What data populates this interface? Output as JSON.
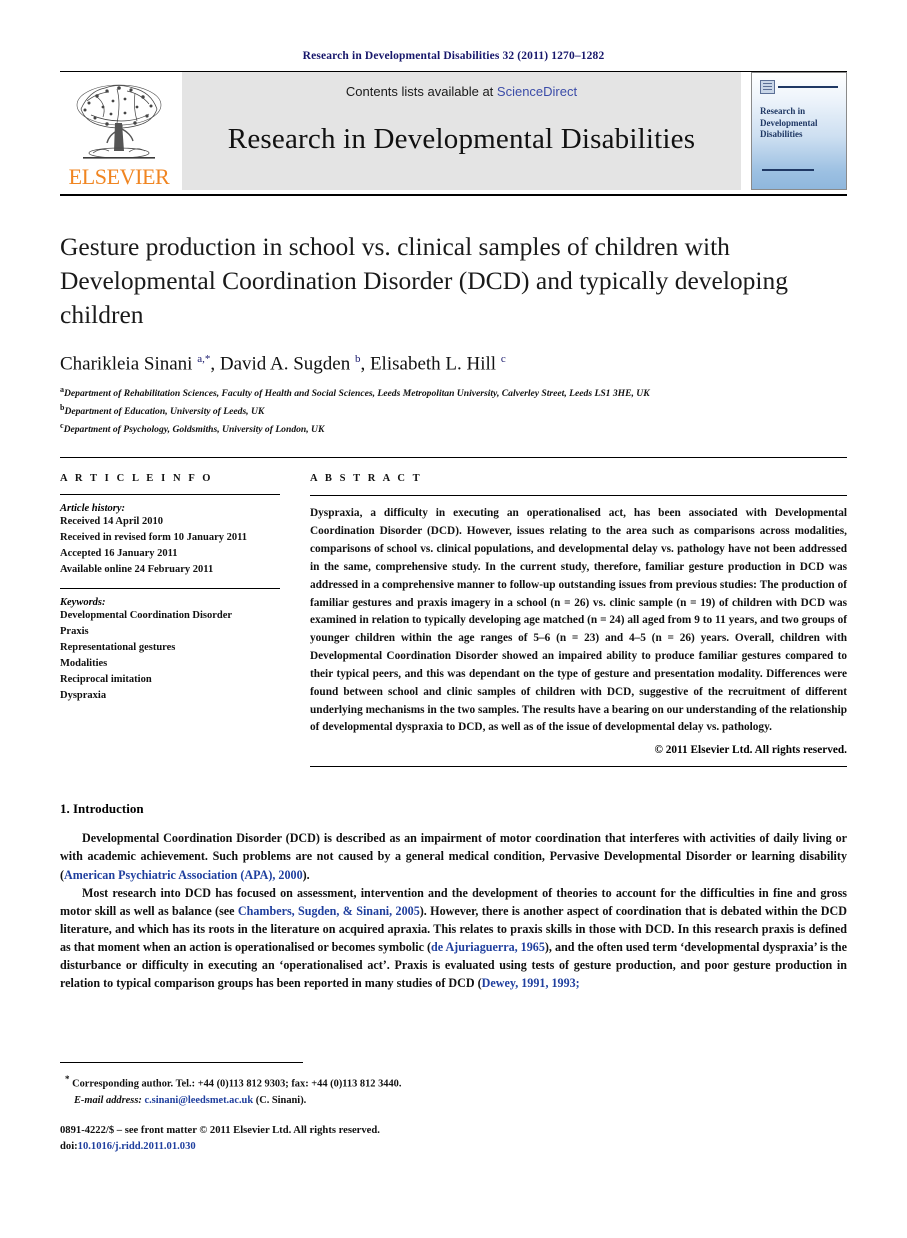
{
  "running_head": "Research in Developmental Disabilities 32 (2011) 1270–1282",
  "masthead": {
    "publisher_name": "ELSEVIER",
    "contents_prefix": "Contents lists available at ",
    "sciencedirect": "ScienceDirect",
    "journal_name": "Research in Developmental Disabilities",
    "cover_title": "Research in Developmental Disabilities",
    "link_color": "#3b4ca8",
    "publisher_color": "#f08521"
  },
  "article": {
    "title": "Gesture production in school vs. clinical samples of children with Developmental Coordination Disorder (DCD) and typically developing children",
    "authors_html": "Charikleia Sinani <sup>a,*</sup>, David A. Sugden <sup>b</sup>, Elisabeth L. Hill <sup>c</sup>",
    "affiliations": [
      {
        "marker": "a",
        "text": "Department of Rehabilitation Sciences, Faculty of Health and Social Sciences, Leeds Metropolitan University, Calverley Street, Leeds LS1 3HE, UK"
      },
      {
        "marker": "b",
        "text": "Department of Education, University of Leeds, UK"
      },
      {
        "marker": "c",
        "text": "Department of Psychology, Goldsmiths, University of London, UK"
      }
    ]
  },
  "article_info": {
    "label": "A R T I C L E   I N F O",
    "history_label": "Article history:",
    "history": [
      "Received 14 April 2010",
      "Received in revised form 10 January 2011",
      "Accepted 16 January 2011",
      "Available online 24 February 2011"
    ],
    "keywords_label": "Keywords:",
    "keywords": [
      "Developmental Coordination Disorder",
      "Praxis",
      "Representational gestures",
      "Modalities",
      "Reciprocal imitation",
      "Dyspraxia"
    ]
  },
  "abstract": {
    "label": "A B S T R A C T",
    "text": "Dyspraxia, a difficulty in executing an operationalised act, has been associated with Developmental Coordination Disorder (DCD). However, issues relating to the area such as comparisons across modalities, comparisons of school vs. clinical populations, and developmental delay vs. pathology have not been addressed in the same, comprehensive study. In the current study, therefore, familiar gesture production in DCD was addressed in a comprehensive manner to follow-up outstanding issues from previous studies: The production of familiar gestures and praxis imagery in a school (n = 26) vs. clinic sample (n = 19) of children with DCD was examined in relation to typically developing age matched (n = 24) all aged from 9 to 11 years, and two groups of younger children within the age ranges of 5–6 (n = 23) and 4–5 (n = 26) years. Overall, children with Developmental Coordination Disorder showed an impaired ability to produce familiar gestures compared to their typical peers, and this was dependant on the type of gesture and presentation modality. Differences were found between school and clinic samples of children with DCD, suggestive of the recruitment of different underlying mechanisms in the two samples. The results have a bearing on our understanding of the relationship of developmental dyspraxia to DCD, as well as of the issue of developmental delay vs. pathology.",
    "copyright": "© 2011 Elsevier Ltd. All rights reserved."
  },
  "introduction": {
    "heading": "1. Introduction",
    "paragraph_1": {
      "part_1": "Developmental Coordination Disorder (DCD) is described as an impairment of motor coordination that interferes with activities of daily living or with academic achievement. Such problems are not caused by a general medical condition, Pervasive Developmental Disorder or learning disability (",
      "citation_1": "American Psychiatric Association (APA), 2000",
      "part_2": ")."
    },
    "paragraph_2": {
      "part_1": "Most research into DCD has focused on assessment, intervention and the development of theories to account for the difficulties in fine and gross motor skill as well as balance (see ",
      "citation_1": "Chambers, Sugden, & Sinani, 2005",
      "part_2": "). However, there is another aspect of coordination that is debated within the DCD literature, and which has its roots in the literature on acquired apraxia. This relates to praxis skills in those with DCD. In this research praxis is defined as that moment when an action is operationalised or becomes symbolic (",
      "citation_2": "de Ajuriaguerra, 1965",
      "part_3": "), and the often used term ‘developmental dyspraxia’ is the disturbance or difficulty in executing an ‘operationalised act’. Praxis is evaluated using tests of gesture production, and poor gesture production in relation to typical comparison groups has been reported in many studies of DCD (",
      "citation_3": "Dewey, 1991, 1993;",
      "part_4": ""
    }
  },
  "footnote": {
    "corresponding": "Corresponding author. Tel.: +44 (0)113 812 9303; fax: +44 (0)113 812 3440.",
    "email_label": "E-mail address:",
    "email": "c.sinani@leedsmet.ac.uk",
    "email_suffix": "(C. Sinani)."
  },
  "imprint": {
    "front_matter": "0891-4222/$ – see front matter © 2011 Elsevier Ltd. All rights reserved.",
    "doi_label": "doi:",
    "doi": "10.1016/j.ridd.2011.01.030"
  }
}
